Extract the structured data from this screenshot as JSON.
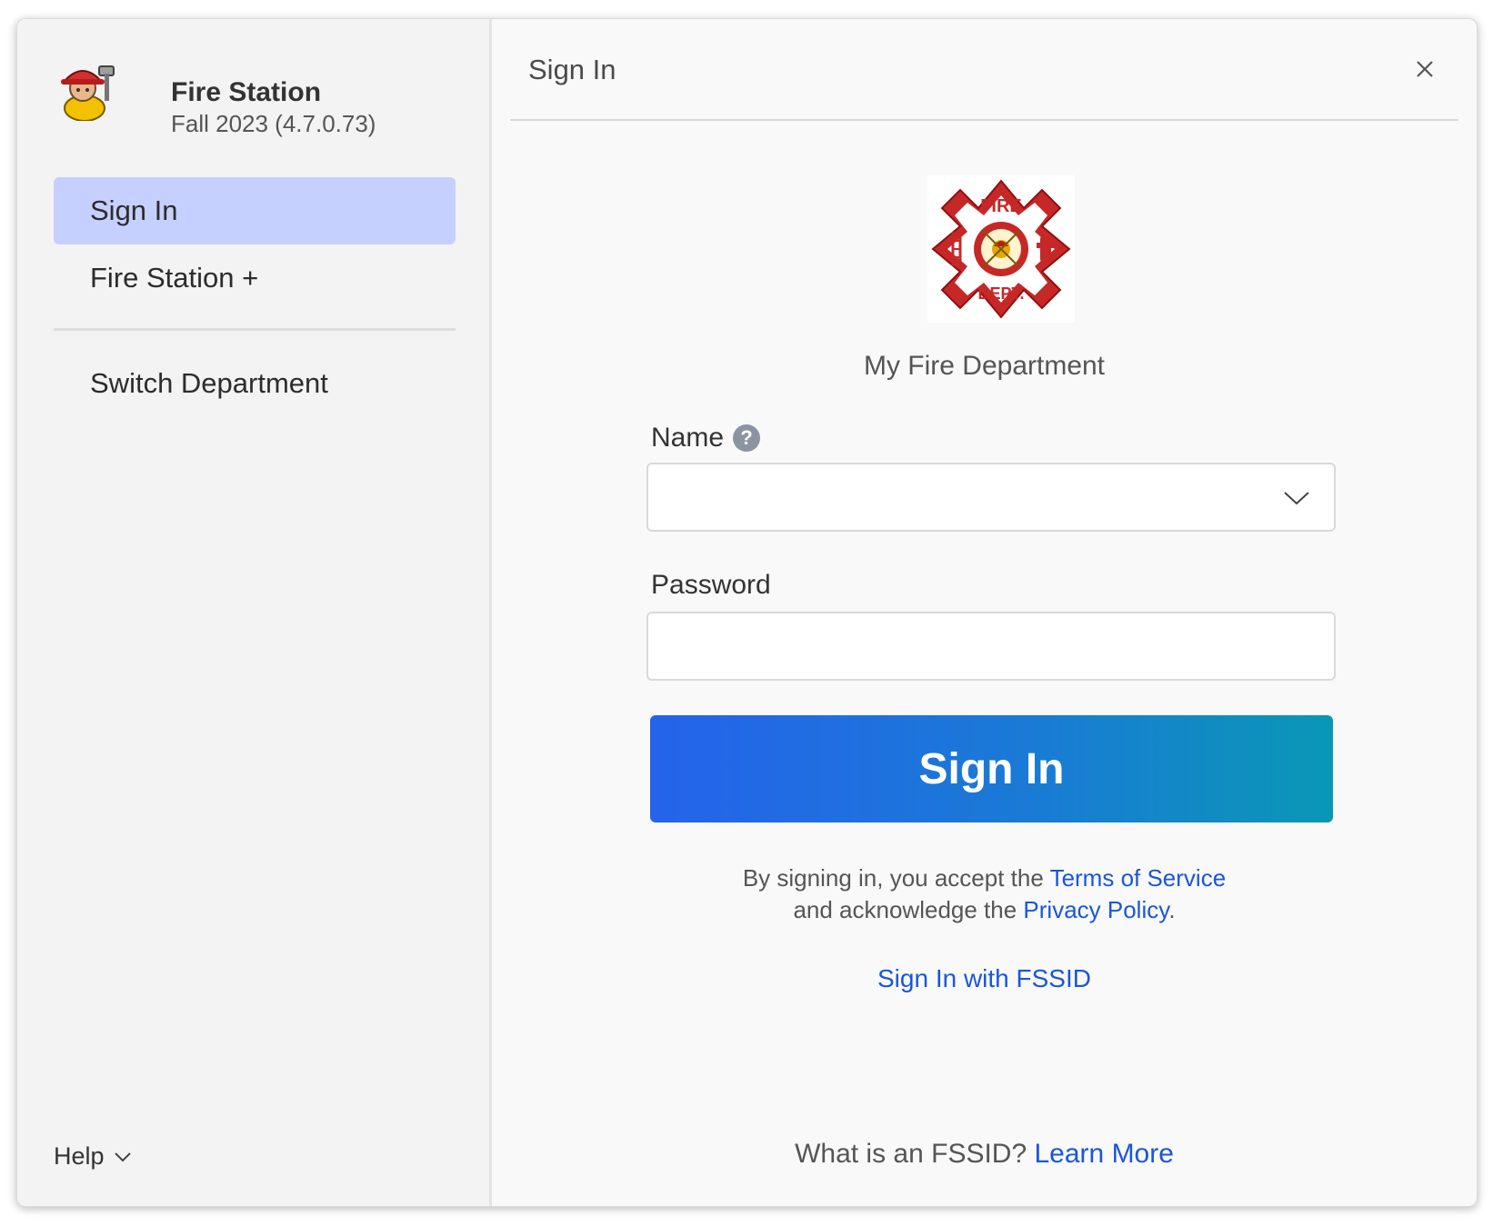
{
  "app": {
    "name": "Fire Station",
    "version": "Fall 2023 (4.7.0.73)"
  },
  "sidebar": {
    "items": [
      {
        "label": "Sign In",
        "active": true
      },
      {
        "label": "Fire Station +"
      },
      {
        "label": "Switch Department"
      }
    ],
    "help_label": "Help"
  },
  "main": {
    "title": "Sign In",
    "department_name": "My Fire Department",
    "name_label": "Name",
    "name_help": "?",
    "name_value": "",
    "password_label": "Password",
    "signin_label": "Sign In",
    "terms": {
      "prefix": "By signing in, you accept the ",
      "terms_link": "Terms of Service",
      "middle": "and acknowledge the ",
      "privacy_link": "Privacy Policy",
      "suffix": "."
    },
    "fssid_link": "Sign In with FSSID",
    "fssid_question": "What is an FSSID? ",
    "learn_more": "Learn More"
  },
  "colors": {
    "accent_selected": "#c6d0ff",
    "link": "#1a56db",
    "button_gradient_start": "#2563eb",
    "button_gradient_end": "#0a97b6",
    "logo_red": "#c62828"
  },
  "icons": {
    "app_logo": "firefighter-icon",
    "department_logo": "maltese-cross-fire-dept-badge",
    "close": "close-icon",
    "dropdown": "chevron-down-icon",
    "help_menu": "chevron-down-icon",
    "name_help": "question-circle-icon"
  },
  "logo_text": {
    "top": "FIRE",
    "bottom": "DEPT."
  }
}
